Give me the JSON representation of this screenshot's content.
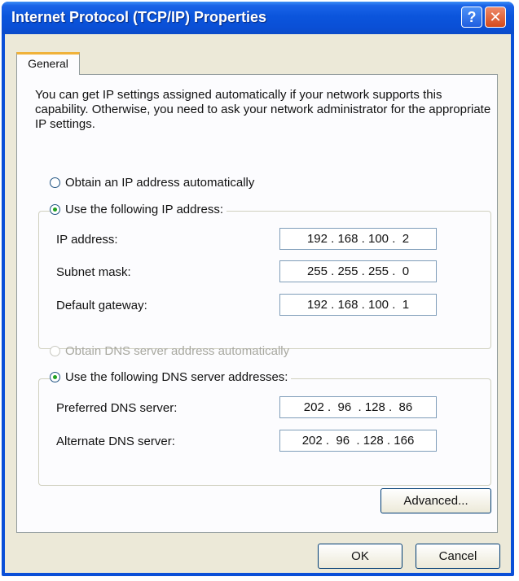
{
  "window": {
    "title": "Internet Protocol (TCP/IP) Properties",
    "help_label": "?",
    "close_label": "✕"
  },
  "tabs": [
    {
      "label": "General",
      "selected": true
    }
  ],
  "general": {
    "intro": "You can get IP settings assigned automatically if your network supports this capability. Otherwise, you need to ask your network administrator for the appropriate IP settings.",
    "ip_options": {
      "auto_label": "Obtain an IP address automatically",
      "manual_label": "Use the following IP address:",
      "selected": "manual"
    },
    "ip_fields": {
      "ip_address": {
        "label": "IP address:",
        "value": "192 . 168 . 100 .  2"
      },
      "subnet_mask": {
        "label": "Subnet mask:",
        "value": "255 . 255 . 255 .  0"
      },
      "default_gateway": {
        "label": "Default gateway:",
        "value": "192 . 168 . 100 .  1"
      }
    },
    "dns_options": {
      "auto_label": "Obtain DNS server address automatically",
      "manual_label": "Use the following DNS server addresses:",
      "selected": "manual",
      "auto_disabled": true
    },
    "dns_fields": {
      "preferred": {
        "label": "Preferred DNS server:",
        "value": "202 .  96  . 128 .  86"
      },
      "alternate": {
        "label": "Alternate DNS server:",
        "value": "202 .  96  . 128 . 166"
      }
    },
    "advanced_label": "Advanced..."
  },
  "footer": {
    "ok_label": "OK",
    "cancel_label": "Cancel"
  },
  "colors": {
    "titlebar": "#0a4fd8",
    "dialog_face": "#ece9d8",
    "radio_dot": "#21a121",
    "tab_highlight": "#f0b23a"
  }
}
